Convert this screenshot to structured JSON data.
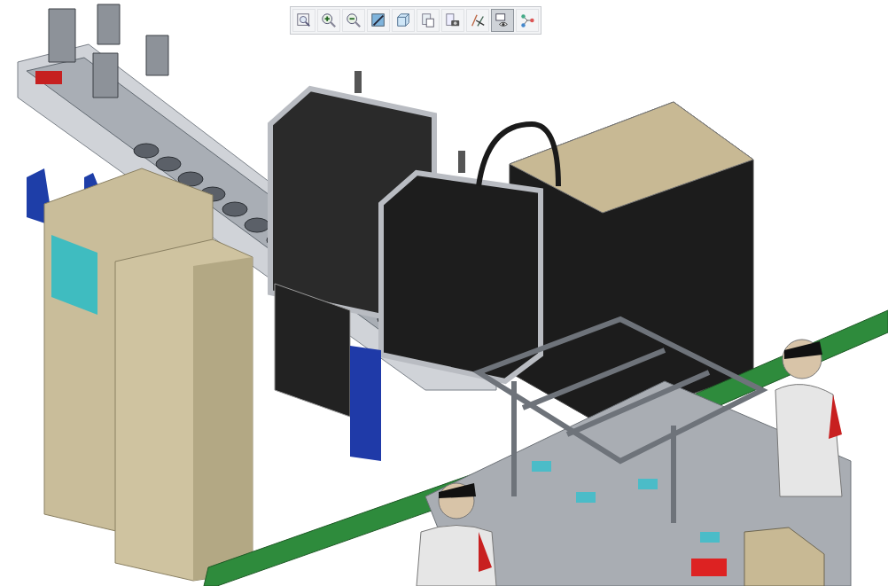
{
  "toolbar": {
    "tools": [
      {
        "kind": "zoom-fit",
        "selected": false
      },
      {
        "kind": "zoom-in",
        "selected": false
      },
      {
        "kind": "zoom-out",
        "selected": false
      },
      {
        "kind": "shading",
        "selected": false
      },
      {
        "kind": "view-cube",
        "selected": false
      },
      {
        "kind": "layers",
        "selected": false
      },
      {
        "kind": "camera",
        "selected": false
      },
      {
        "kind": "datum",
        "selected": false
      },
      {
        "kind": "visibility",
        "selected": true
      },
      {
        "kind": "network",
        "selected": false
      }
    ]
  }
}
